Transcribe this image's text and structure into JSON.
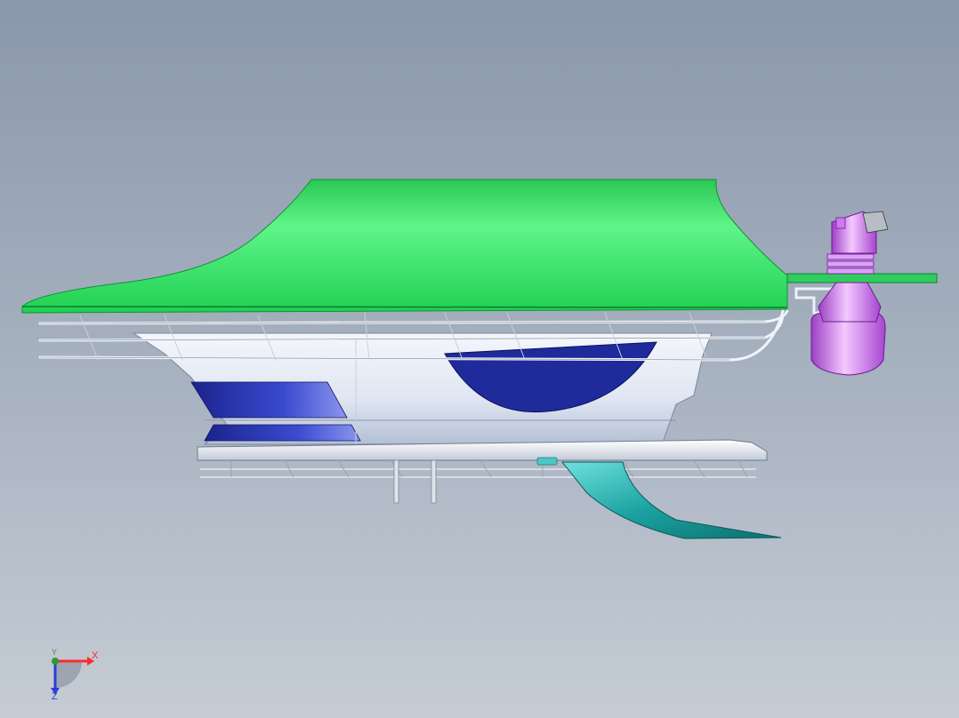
{
  "viewport": {
    "background_top": "#8b98ab",
    "background_bottom": "#c5ccd5"
  },
  "model": {
    "colors": {
      "canopy": "#33e066",
      "canopy_highlight": "#5ff58a",
      "hull": "#e6ebf5",
      "hull_shade": "#b9c3d6",
      "accent_blue": "#1f2a9b",
      "fin": "#1aa2a0",
      "valve": "#c65ae8",
      "rail": "#e8edf5"
    },
    "parts": [
      "canopy",
      "hull",
      "railing",
      "base-plate",
      "fin",
      "valve-assembly",
      "mount-bracket"
    ]
  },
  "triad": {
    "x_label": "X",
    "y_label": "Y",
    "z_label": "Z",
    "x_color": "#ff2a2a",
    "y_color": "#2f9a2f",
    "z_color": "#2a3fd8"
  }
}
